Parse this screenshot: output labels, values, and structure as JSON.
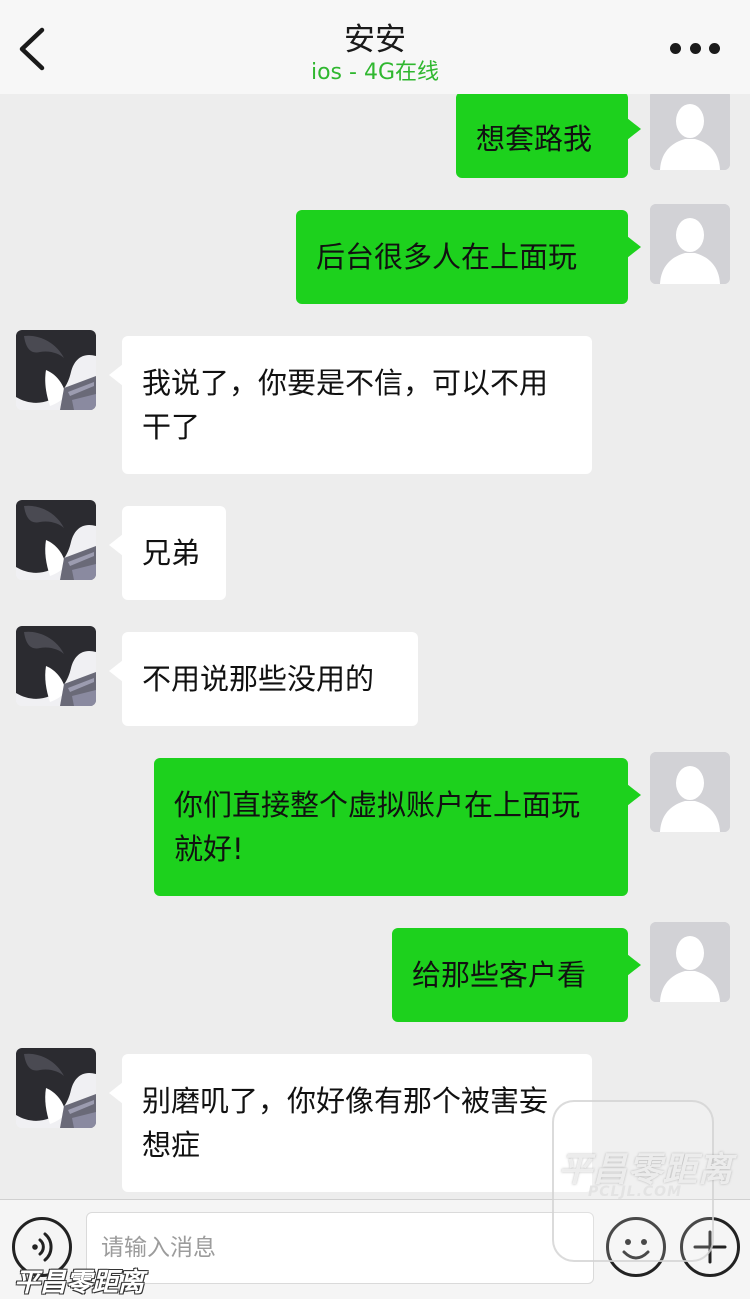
{
  "header": {
    "title": "安安",
    "status": "ios - 4G在线"
  },
  "messages": [
    {
      "from": "me",
      "text": "想套路我"
    },
    {
      "from": "me",
      "text": "后台很多人在上面玩"
    },
    {
      "from": "friend",
      "text": "我说了，你要是不信，可以不用干了"
    },
    {
      "from": "friend",
      "text": "兄弟"
    },
    {
      "from": "friend",
      "text": "不用说那些没用的"
    },
    {
      "from": "me",
      "text": "你们直接整个虚拟账户在上面玩就好!"
    },
    {
      "from": "me",
      "text": "给那些客户看"
    },
    {
      "from": "friend",
      "text": "别磨叽了，你好像有那个被害妄想症"
    }
  ],
  "input": {
    "placeholder": "请输入消息"
  },
  "watermark": {
    "name": "平昌零距离",
    "url": "PCLJL.COM"
  },
  "colors": {
    "my_bubble": "#1dd11d",
    "friend_bubble": "#ffffff",
    "status_green": "#2fb72f"
  },
  "icons": [
    "back-arrow-icon",
    "more-dots-icon",
    "voice-icon",
    "emoji-icon",
    "plus-icon",
    "user-avatar-icon"
  ]
}
